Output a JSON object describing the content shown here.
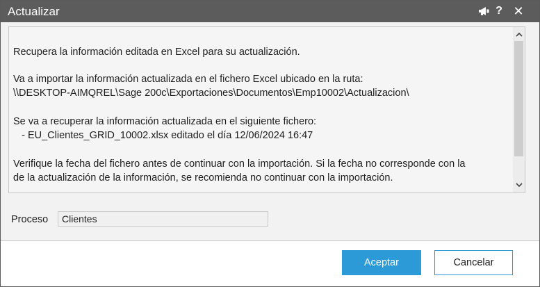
{
  "window": {
    "title": "Actualizar",
    "pin_icon": "megaphone-icon",
    "help_label": "?",
    "close_label": "✕"
  },
  "message": {
    "line1": "Recupera la información editada en Excel para su actualización.",
    "line2": "Va a importar la información actualizada en el fichero Excel ubicado en la ruta:",
    "line3": "\\\\DESKTOP-AIMQREL\\Sage 200c\\Exportaciones\\Documentos\\Emp10002\\Actualizacion\\",
    "line4": "Se va a recuperar la información actualizada en el siguiente fichero:",
    "line5": "   - EU_Clientes_GRID_10002.xlsx editado el día 12/06/2024 16:47",
    "line6": "Verifique la fecha del fichero antes de continuar con la importación. Si la fecha no corresponde con la",
    "line7": "de la actualización de la información, se recomienda no continuar con la importación."
  },
  "process": {
    "label": "Proceso",
    "value": "Clientes"
  },
  "buttons": {
    "accept": "Aceptar",
    "cancel": "Cancelar"
  },
  "colors": {
    "titlebar": "#5c5c5c",
    "accent": "#2b9ad6"
  }
}
